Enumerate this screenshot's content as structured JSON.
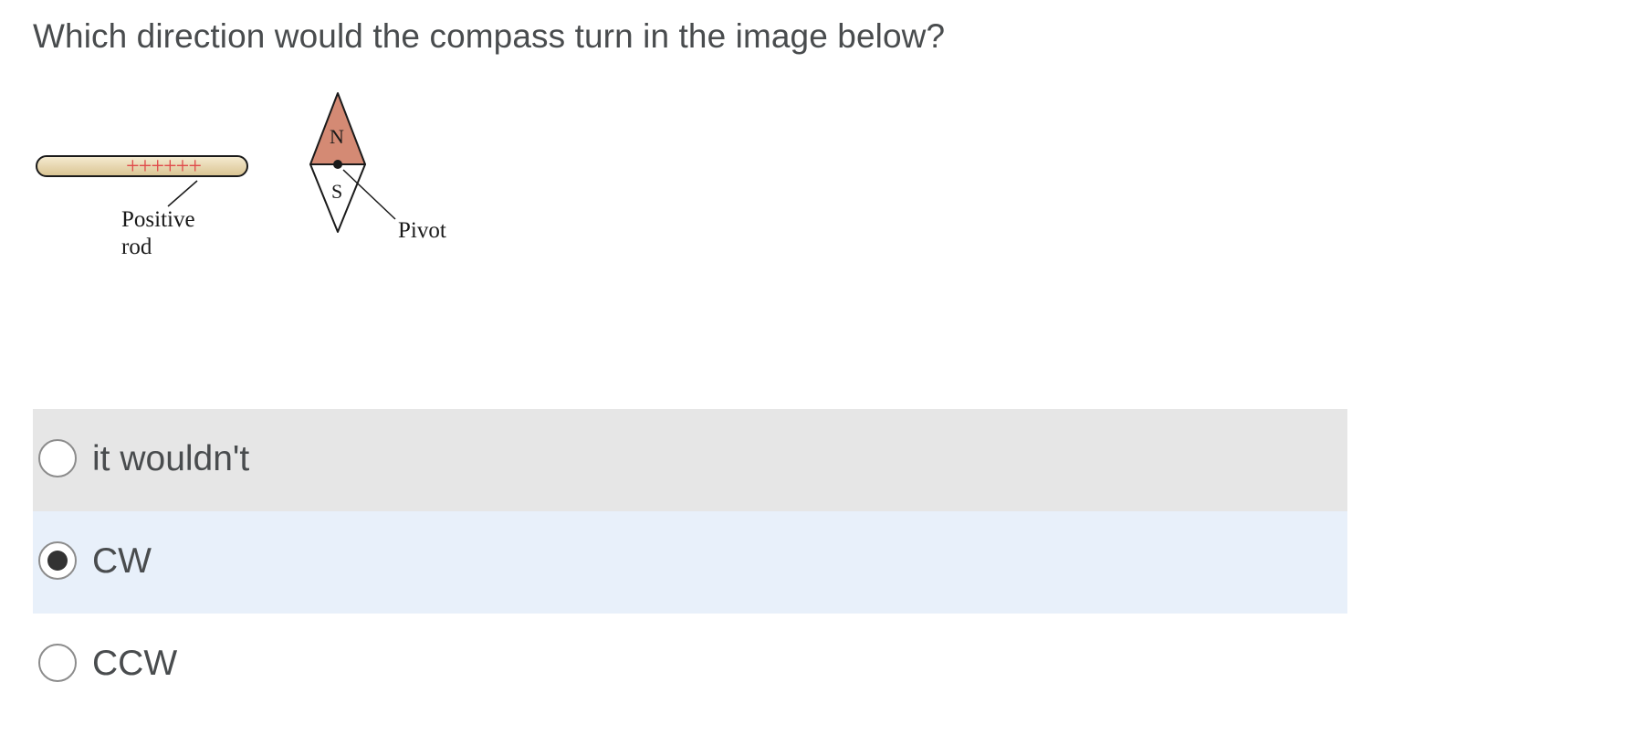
{
  "question": {
    "text": "Which direction would the compass turn in the image below?"
  },
  "figure": {
    "rod_charges": "++++++",
    "rod_label_line1": "Positive",
    "rod_label_line2": "rod",
    "compass_north": "N",
    "compass_south": "S",
    "pivot_label": "Pivot",
    "colors": {
      "rod_fill": "#ecdcb6",
      "charge_color": "#e04a4a",
      "north_fill": "#d48a74"
    }
  },
  "options": [
    {
      "label": "it wouldn't",
      "selected": false,
      "state": "hover"
    },
    {
      "label": "CW",
      "selected": true,
      "state": "selected"
    },
    {
      "label": "CCW",
      "selected": false,
      "state": "normal"
    }
  ],
  "colors": {
    "text": "#494c4e",
    "hover_bg": "#e6e6e6",
    "selected_bg": "#e8f0fa"
  }
}
